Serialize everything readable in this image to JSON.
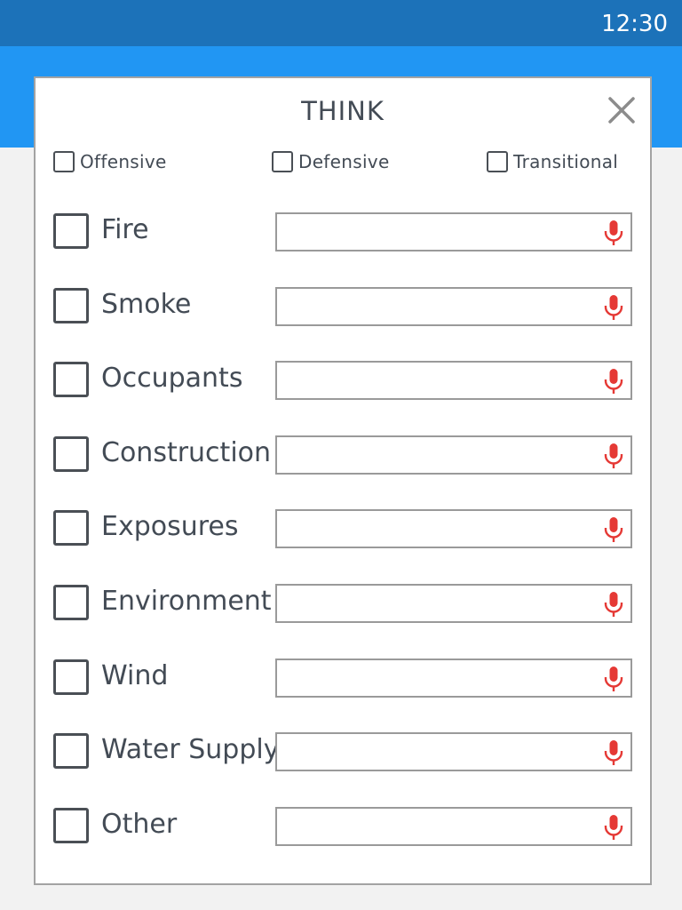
{
  "status_bar": {
    "time": "12:30"
  },
  "dialog": {
    "title": "THINK",
    "close_icon": "close-icon",
    "modes": [
      {
        "label": "Offensive",
        "checked": false
      },
      {
        "label": "Defensive",
        "checked": false
      },
      {
        "label": "Transitional",
        "checked": false
      }
    ],
    "fields": [
      {
        "label": "Fire",
        "value": "",
        "checked": false
      },
      {
        "label": "Smoke",
        "value": "",
        "checked": false
      },
      {
        "label": "Occupants",
        "value": "",
        "checked": false
      },
      {
        "label": "Construction",
        "value": "",
        "checked": false
      },
      {
        "label": "Exposures",
        "value": "",
        "checked": false
      },
      {
        "label": "Environment",
        "value": "",
        "checked": false
      },
      {
        "label": "Wind",
        "value": "",
        "checked": false
      },
      {
        "label": "Water Supply",
        "value": "",
        "checked": false
      },
      {
        "label": "Other",
        "value": "",
        "checked": false
      }
    ],
    "mic_icon": "microphone-icon"
  },
  "colors": {
    "status_bar": "#1c72b9",
    "action_bar": "#2196f3",
    "mic": "#e53935",
    "text": "#434b55",
    "background": "#f2f2f2"
  }
}
